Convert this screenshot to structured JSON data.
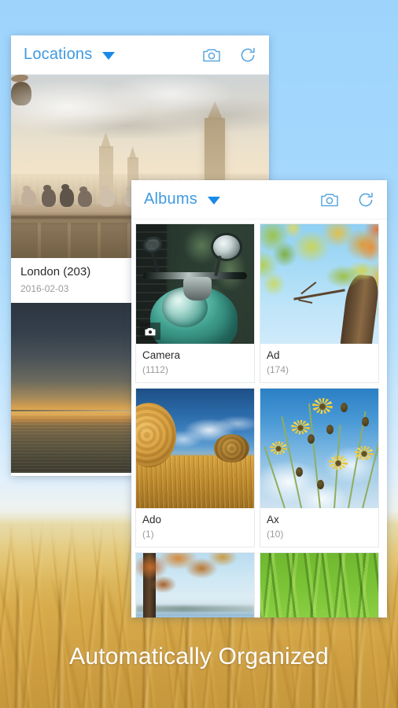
{
  "tagline": "Automatically Organized",
  "locations_card": {
    "header": {
      "title": "Locations",
      "dropdown_icon": "chevron-down-icon",
      "camera_icon": "camera-icon",
      "refresh_icon": "refresh-icon"
    },
    "items": [
      {
        "name": "London (203)",
        "date": "2016-02-03",
        "photo": "london-birds-big-ben-sunset"
      },
      {
        "name": "",
        "date": "",
        "photo": "kayaker-at-sunset-on-lake"
      }
    ]
  },
  "albums_card": {
    "header": {
      "title": "Albums",
      "dropdown_icon": "chevron-down-icon",
      "camera_icon": "camera-icon",
      "refresh_icon": "refresh-icon"
    },
    "rows": [
      [
        {
          "name": "Camera",
          "count": "(1112)",
          "photo": "teal-vintage-scooter",
          "badge": "camera-icon"
        },
        {
          "name": "Ad",
          "count": "(174)",
          "photo": "tree-canopy-looking-up",
          "badge": ""
        }
      ],
      [
        {
          "name": "Ado",
          "count": "(1)",
          "photo": "hay-bales-in-golden-field",
          "badge": ""
        },
        {
          "name": "Ax",
          "count": "(10)",
          "photo": "yellow-coneflowers-blue-sky",
          "badge": ""
        }
      ],
      [
        {
          "name": "",
          "count": "",
          "photo": "autumn-tree-by-misty-lake",
          "badge": ""
        },
        {
          "name": "",
          "count": "",
          "photo": "green-grass-blades-closeup",
          "badge": ""
        }
      ]
    ]
  },
  "colors": {
    "accent_blue": "#3f9ae0",
    "caret_blue": "#1b8ae6",
    "icon_blue": "#5aa7de",
    "background_sky": "#9ed4fc",
    "card_white": "#ffffff",
    "primary_text": "#2b2b2b",
    "secondary_text": "#9b9b9b",
    "tagline_text": "#ffffff"
  }
}
